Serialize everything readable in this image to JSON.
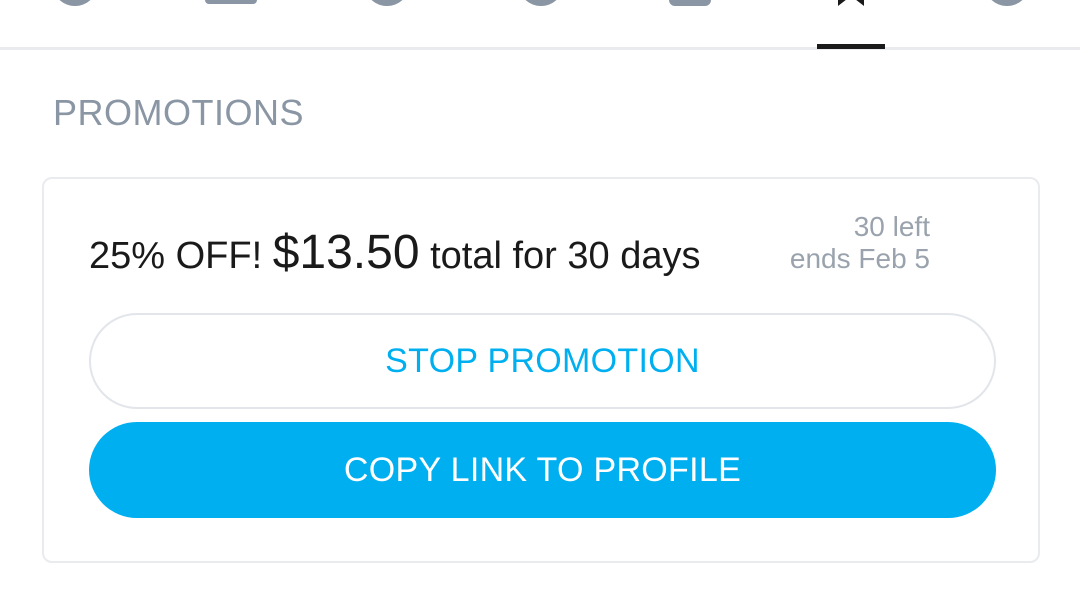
{
  "tabs": [
    {
      "icon": "profile-icon"
    },
    {
      "icon": "media-icon"
    },
    {
      "icon": "user-icon"
    },
    {
      "icon": "clock-icon"
    },
    {
      "icon": "document-icon"
    },
    {
      "icon": "bookmark-icon",
      "active": true
    },
    {
      "icon": "settings-icon"
    }
  ],
  "promotions": {
    "section_title": "PROMOTIONS",
    "item": {
      "discount_label": "25% OFF!",
      "price": "$13.50",
      "duration_label": "total for 30 days",
      "remaining": "30 left",
      "ends": "ends Feb 5"
    },
    "stop_button_label": "STOP PROMOTION",
    "copy_button_label": "COPY LINK TO PROFILE"
  },
  "colors": {
    "accent": "#00aff0",
    "muted_text": "#8a96a3",
    "border": "#e9ebee"
  }
}
